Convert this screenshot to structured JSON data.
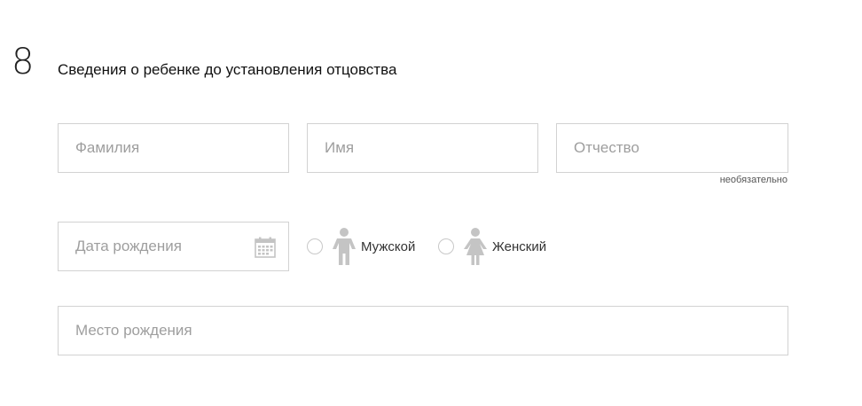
{
  "section": {
    "number": "8",
    "title": "Сведения о ребенке до установления отцовства"
  },
  "fields": {
    "surname": {
      "placeholder": "Фамилия",
      "value": ""
    },
    "name": {
      "placeholder": "Имя",
      "value": ""
    },
    "patronymic": {
      "placeholder": "Отчество",
      "value": "",
      "note": "необязательно"
    },
    "birthdate": {
      "placeholder": "Дата рождения",
      "value": "",
      "icon": "calendar-icon"
    },
    "birthplace": {
      "placeholder": "Место рождения",
      "value": ""
    }
  },
  "gender": {
    "options": [
      {
        "label": "Мужской",
        "icon": "male-person-icon",
        "selected": false
      },
      {
        "label": "Женский",
        "icon": "female-person-icon",
        "selected": false
      }
    ]
  },
  "colors": {
    "border": "#d2d2d2",
    "placeholder": "#9e9e9e",
    "icon": "#c4c4c4"
  }
}
